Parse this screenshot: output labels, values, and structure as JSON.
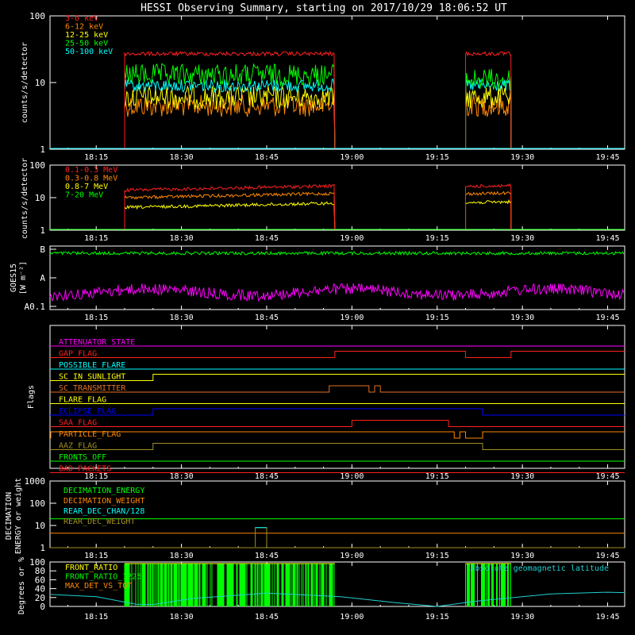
{
  "title": "HESSI Observing Summary, starting on 2017/10/29 18:06:52 UT",
  "colors": {
    "bg": "#000000",
    "axis": "#ffffff",
    "red": "#ff2020",
    "orange": "#ff8800",
    "yellow": "#ffff00",
    "green": "#00ff00",
    "cyan": "#00ffff",
    "magenta": "#ff00ff",
    "blue": "#0000ff",
    "olive": "#a08f20",
    "darkorange": "#e07020"
  },
  "time_ticks": [
    "18:15",
    "18:30",
    "18:45",
    "19:00",
    "19:15",
    "19:30",
    "19:45"
  ],
  "chart_data": [
    {
      "type": "line",
      "panel": "low_energy_rates",
      "ylabel": "counts/s/detector",
      "yscale": "log",
      "ylim": [
        1,
        100
      ],
      "ytick_labels": [
        "1",
        "10",
        "100"
      ],
      "series": [
        {
          "name": "3-6 keV",
          "color": "#ff2020",
          "segments": [
            {
              "x": [
                "18:20",
                "18:57"
              ],
              "y": 27
            },
            {
              "x": [
                "19:20",
                "19:28"
              ],
              "y": 27
            }
          ]
        },
        {
          "name": "6-12 keV",
          "color": "#ff8800",
          "segments": [
            {
              "x": [
                "18:20",
                "18:57"
              ],
              "y": 4.5
            },
            {
              "x": [
                "19:20",
                "19:28"
              ],
              "y": 4.5
            }
          ]
        },
        {
          "name": "12-25 keV",
          "color": "#ffff00",
          "segments": [
            {
              "x": [
                "18:20",
                "18:57"
              ],
              "y": 6
            },
            {
              "x": [
                "19:20",
                "19:28"
              ],
              "y": 6
            }
          ]
        },
        {
          "name": "25-50 keV",
          "color": "#00ff00",
          "segments": [
            {
              "x": [
                "18:20",
                "18:57"
              ],
              "y": 13
            },
            {
              "x": [
                "19:20",
                "19:28"
              ],
              "y": 11
            }
          ]
        },
        {
          "name": "50-100 keV",
          "color": "#00ffff",
          "segments": [
            {
              "x": [
                "18:20",
                "18:57"
              ],
              "y": 9
            },
            {
              "x": [
                "19:20",
                "19:28"
              ],
              "y": 9
            }
          ]
        }
      ]
    },
    {
      "type": "line",
      "panel": "high_energy_rates",
      "ylabel": "counts/s/detector",
      "yscale": "log",
      "ylim": [
        1,
        100
      ],
      "ytick_labels": [
        "1",
        "10",
        "100"
      ],
      "series": [
        {
          "name": "0.1-0.3 MeV",
          "color": "#ff2020",
          "segments": [
            {
              "x": [
                "18:20",
                "18:57"
              ],
              "y": 17
            },
            {
              "x": [
                "19:20",
                "19:28"
              ],
              "y": 22
            }
          ]
        },
        {
          "name": "0.3-0.8 MeV",
          "color": "#ff8800",
          "segments": [
            {
              "x": [
                "18:20",
                "18:57"
              ],
              "y": 10
            },
            {
              "x": [
                "19:20",
                "19:28"
              ],
              "y": 13
            }
          ]
        },
        {
          "name": "0.8-7 MeV",
          "color": "#ffff00",
          "segments": [
            {
              "x": [
                "18:20",
                "18:57"
              ],
              "y": 5
            },
            {
              "x": [
                "19:20",
                "19:28"
              ],
              "y": 7
            }
          ]
        },
        {
          "name": "7-20 MeV",
          "color": "#00ff00",
          "segments": [
            {
              "x": [
                "18:07",
                "19:48"
              ],
              "y": 1
            }
          ]
        }
      ]
    },
    {
      "type": "line",
      "panel": "goes",
      "ylabel": "GOES15 [W m⁻²]",
      "ytick_labels": [
        "A0.1",
        "A",
        "B"
      ],
      "series": [
        {
          "name": "",
          "color": "#00ff00",
          "level": "B",
          "note_level": 0.95
        },
        {
          "name": "",
          "color": "#ff00ff",
          "level": "A0.1-A",
          "note_level": 0.25
        }
      ]
    },
    {
      "type": "table",
      "panel": "flags",
      "ylabel": "Flags",
      "flags": [
        {
          "name": "ATTENUATOR_STATE",
          "color": "#ff00ff",
          "transitions": []
        },
        {
          "name": "GAP_FLAG",
          "color": "#ff2020",
          "transitions": [
            "18:57",
            "19:20",
            "19:28"
          ]
        },
        {
          "name": "POSSIBLE_FLARE",
          "color": "#00ffff",
          "transitions": []
        },
        {
          "name": "SC_IN_SUNLIGHT",
          "color": "#ffff00",
          "transitions": [
            "18:25"
          ]
        },
        {
          "name": "SC_TRANSMITTER",
          "color": "#e07020",
          "transitions": [
            "18:56",
            "19:03",
            "19:04",
            "19:05"
          ]
        },
        {
          "name": "FLARE_FLAG",
          "color": "#ffff00",
          "transitions": []
        },
        {
          "name": "ECLIPSE_FLAG",
          "color": "#0000ff",
          "transitions": [
            "18:25",
            "19:23"
          ]
        },
        {
          "name": "SAA_FLAG",
          "color": "#ff2020",
          "transitions": [
            "19:00",
            "19:17"
          ]
        },
        {
          "name": "PARTICLE_FLAG",
          "color": "#ff8800",
          "transitions": [
            "18:07",
            "19:18",
            "19:19",
            "19:20",
            "19:23"
          ]
        },
        {
          "name": "AAZ_FLAG",
          "color": "#a08f20",
          "transitions": [
            "18:25",
            "19:23"
          ]
        },
        {
          "name": "FRONTS_OFF",
          "color": "#00ff00",
          "transitions": []
        },
        {
          "name": "BAD_PACKETS",
          "color": "#ff2020",
          "transitions": []
        }
      ]
    },
    {
      "type": "line",
      "panel": "decimation",
      "ylabel": "DECIMATION ENERGY or weight",
      "yscale": "log",
      "ylim": [
        1,
        1000
      ],
      "ytick_labels": [
        "1",
        "10",
        "100",
        "1000"
      ],
      "series": [
        {
          "name": "DECIMATION_ENERGY",
          "color": "#00ff00",
          "y": 20
        },
        {
          "name": "DECIMATION_WEIGHT",
          "color": "#ff8800",
          "y": 4.5
        },
        {
          "name": "REAR_DEC_CHAN/128",
          "color": "#00ffff",
          "y": 0
        },
        {
          "name": "REAR_DEC_WEIGHT",
          "color": "#a08f20",
          "y": 1,
          "bump": {
            "x": [
              "18:43",
              "18:45"
            ],
            "y": 8
          }
        }
      ]
    },
    {
      "type": "line",
      "panel": "ratios",
      "ylabel": "Degrees or %",
      "ylim": [
        0,
        100
      ],
      "ytick_labels": [
        "0",
        "20",
        "40",
        "60",
        "80",
        "100"
      ],
      "annotation": "Absolute geomagnetic latitude",
      "series": [
        {
          "name": "FRONT_RATIO",
          "color": "#ffff00"
        },
        {
          "name": "FRONT_RATIO_1225",
          "color": "#00ff00",
          "bursts": [
            [
              "18:20",
              "18:57"
            ],
            [
              "19:20",
              "19:28"
            ]
          ]
        },
        {
          "name": "MAX_DET_VS_TOT",
          "color": "#ff8800"
        },
        {
          "name": "Absolute geomagnetic latitude",
          "color": "#20d0d0",
          "points": [
            [
              "18:07",
              27
            ],
            [
              "18:15",
              22
            ],
            [
              "18:22",
              5
            ],
            [
              "18:25",
              4
            ],
            [
              "18:32",
              18
            ],
            [
              "18:45",
              30
            ],
            [
              "18:58",
              22
            ],
            [
              "19:08",
              8
            ],
            [
              "19:15",
              0
            ],
            [
              "19:22",
              12
            ],
            [
              "19:35",
              28
            ],
            [
              "19:45",
              32
            ],
            [
              "19:48",
              31
            ]
          ]
        }
      ]
    }
  ]
}
